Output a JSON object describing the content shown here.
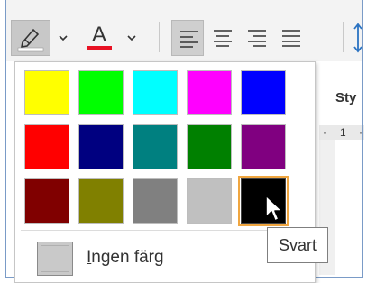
{
  "ribbon": {
    "highlight_button": {
      "icon": "highlighter-icon",
      "indicator_color": "#ffffff"
    },
    "font_color_button": {
      "icon": "font-color-icon",
      "glyph": "A",
      "indicator_color": "#e81123"
    },
    "align_buttons": [
      "align-left",
      "align-center",
      "align-right",
      "justify"
    ],
    "selected_align": "align-left",
    "styles_label": "Sty",
    "ruler_marks": [
      "·",
      "1",
      "·"
    ]
  },
  "color_panel": {
    "rows": [
      [
        {
          "name": "Gul",
          "color": "#ffff00"
        },
        {
          "name": "Ljusgrön",
          "color": "#00ff00"
        },
        {
          "name": "Turkos",
          "color": "#00ffff"
        },
        {
          "name": "Rosa",
          "color": "#ff00ff"
        },
        {
          "name": "Blå",
          "color": "#0000ff"
        }
      ],
      [
        {
          "name": "Röd",
          "color": "#ff0000"
        },
        {
          "name": "Mörkblå",
          "color": "#000080"
        },
        {
          "name": "Blågrön",
          "color": "#008080"
        },
        {
          "name": "Grön",
          "color": "#008000"
        },
        {
          "name": "Violett",
          "color": "#800080"
        }
      ],
      [
        {
          "name": "Mörkröd",
          "color": "#800000"
        },
        {
          "name": "Mörkgul",
          "color": "#808000"
        },
        {
          "name": "Grå 50%",
          "color": "#808080"
        },
        {
          "name": "Grå 25%",
          "color": "#c0c0c0"
        },
        {
          "name": "Svart",
          "color": "#000000"
        }
      ]
    ],
    "selected_swatch": "Svart",
    "no_color_access_key": "I",
    "no_color_rest": "ngen färg"
  },
  "tooltip": {
    "text": "Svart"
  }
}
